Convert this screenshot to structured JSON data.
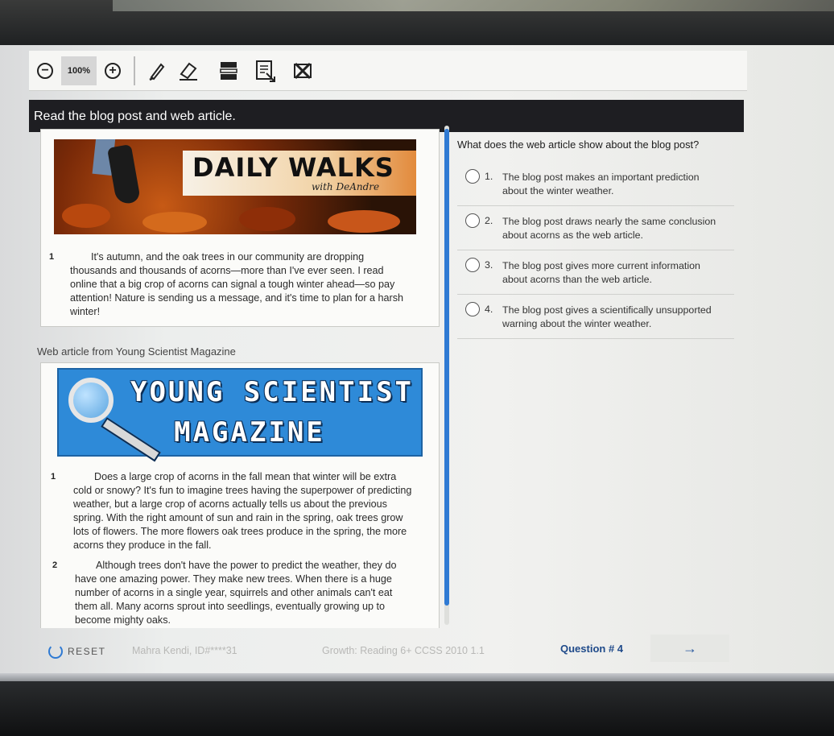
{
  "toolbar": {
    "zoom_out_symbol": "−",
    "zoom_level": "100%",
    "zoom_in_symbol": "+",
    "tools": [
      "pen-icon",
      "eraser-icon",
      "line-reader-icon",
      "answer-masking-icon",
      "cross-out-icon"
    ]
  },
  "directions": "Read the blog post and web article.",
  "blog": {
    "banner_title": "DAILY WALKS",
    "banner_subtitle": "with DeAndre",
    "paragraphs": [
      {
        "num": "1",
        "lines": [
          "It's autumn, and the oak trees in our community are dropping",
          "thousands and thousands of acorns—more than I've ever seen. I read",
          "online that a big crop of acorns can signal a tough winter ahead—so pay",
          "attention! Nature is sending us a message, and it's time to plan for a harsh",
          "winter!"
        ]
      }
    ]
  },
  "web_article": {
    "label": "Web article from Young Scientist Magazine",
    "banner_line1": "YOUNG SCIENTIST",
    "banner_line2": "MAGAZINE",
    "paragraphs": [
      {
        "num": "1",
        "lines": [
          "Does a large crop of acorns in the fall mean that winter will be extra",
          "cold or snowy? It's fun to imagine trees having the superpower of predicting",
          "weather, but a large crop of acorns actually tells us about the previous",
          "spring. With the right amount of sun and rain in the spring, oak trees grow",
          "lots of flowers. The more flowers oak trees produce in the spring, the more",
          "acorns they produce in the fall."
        ]
      },
      {
        "num": "2",
        "lines": [
          "Although trees don't have the power to predict the weather, they do",
          "have one amazing power. They make new trees. When there is a huge",
          "number of acorns in a single year, squirrels and other animals can't eat",
          "them all. Many acorns sprout into seedlings, eventually growing up to",
          "become mighty oaks."
        ]
      }
    ]
  },
  "question": {
    "stem": "What does the web article show about the blog post?",
    "choices": [
      {
        "num": "1.",
        "line1": "The blog post makes an important prediction",
        "line2": "about the winter weather."
      },
      {
        "num": "2.",
        "line1": "The blog post draws nearly the same conclusion",
        "line2": "about acorns as the web article."
      },
      {
        "num": "3.",
        "line1": "The blog post gives more current information",
        "line2": "about acorns than the web article."
      },
      {
        "num": "4.",
        "line1": "The blog post gives a scientifically unsupported",
        "line2": "warning about the winter weather."
      }
    ]
  },
  "footer": {
    "reset_label": "RESET",
    "student": "Mahra Kendi, ID#****31",
    "standard": "Growth: Reading 6+ CCSS 2010 1.1",
    "question_number": "Question # 4",
    "next_symbol": "→"
  },
  "colors": {
    "accent_blue": "#2f7ad3",
    "directions_bg": "#1e1e22",
    "question_number": "#1f4a8a"
  }
}
